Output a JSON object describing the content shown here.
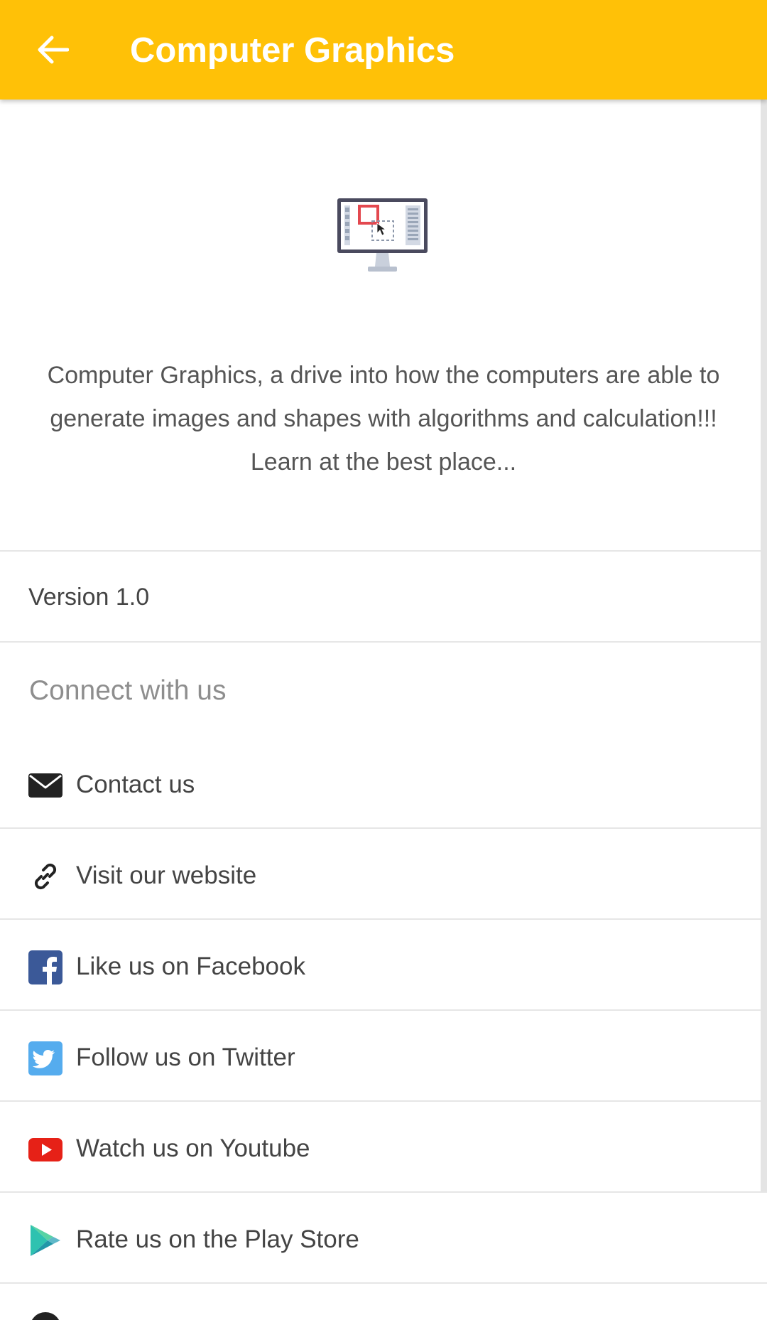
{
  "app_bar": {
    "title": "Computer Graphics",
    "background_color": "#FFC107",
    "back_icon": "arrow-left-icon"
  },
  "hero": {
    "icon": "computer-monitor-graphics-icon",
    "description": "Computer Graphics, a drive into how the computers are able to generate images and shapes with algorithms and calculation!!! Learn at the best place..."
  },
  "version_text": "Version 1.0",
  "connect": {
    "header": "Connect with us",
    "items": [
      {
        "label": "Contact us",
        "icon": "envelope-icon"
      },
      {
        "label": "Visit our website",
        "icon": "link-icon"
      },
      {
        "label": "Like us on Facebook",
        "icon": "facebook-icon",
        "color": "#3B5998"
      },
      {
        "label": "Follow us on Twitter",
        "icon": "twitter-icon",
        "color": "#55ACEE"
      },
      {
        "label": "Watch us on Youtube",
        "icon": "youtube-icon",
        "color": "#E62117"
      },
      {
        "label": "Rate us on the Play Store",
        "icon": "play-store-icon",
        "color": "#2EC2B0"
      }
    ]
  }
}
